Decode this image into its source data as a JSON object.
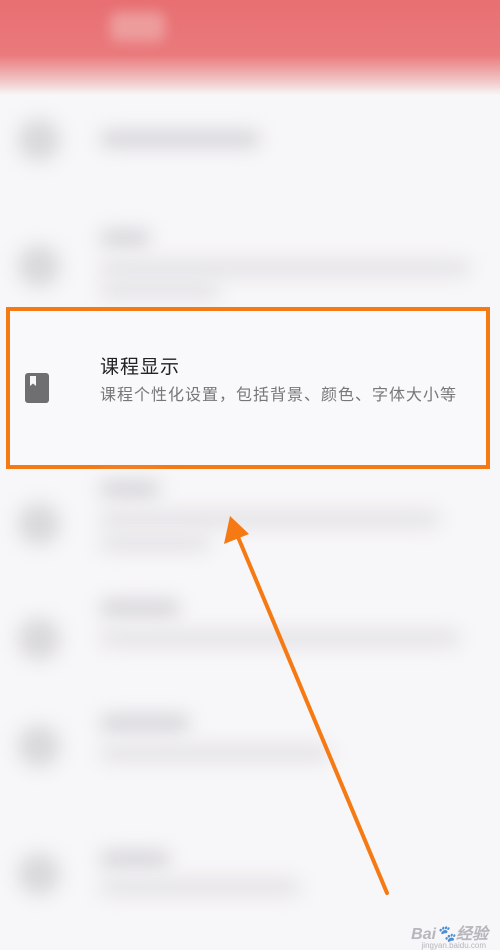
{
  "highlighted_item": {
    "title": "课程显示",
    "description": "课程个性化设置，包括背景、颜色、字体大小等",
    "icon": "bookmark-icon"
  },
  "watermark": {
    "brand": "Bai",
    "sub": "jingyan.baidu.com"
  },
  "colors": {
    "header": "#e86f72",
    "highlight_border": "#f57a14",
    "arrow": "#f57a14"
  }
}
